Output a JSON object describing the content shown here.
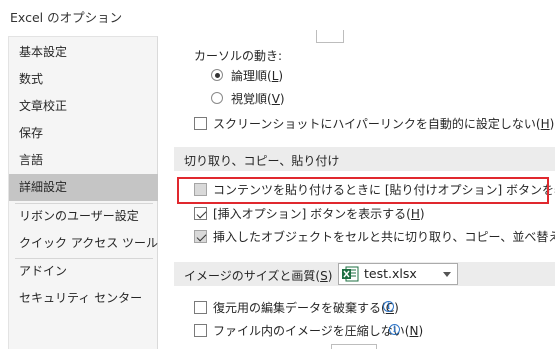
{
  "window": {
    "title": "Excel のオプション"
  },
  "sidebar": {
    "items": [
      {
        "label": "基本設定"
      },
      {
        "label": "数式"
      },
      {
        "label": "文章校正"
      },
      {
        "label": "保存"
      },
      {
        "label": "言語"
      },
      {
        "label": "詳細設定",
        "selected": true
      },
      {
        "label": "リボンのユーザー設定"
      },
      {
        "label": "クイック アクセス ツール バー"
      },
      {
        "label": "アドイン"
      },
      {
        "label": "セキュリティ センター"
      }
    ]
  },
  "cursor_movement": {
    "label": "カーソルの動き:",
    "logical": {
      "text": "論理順(",
      "key": "L",
      "close": ")",
      "selected": true
    },
    "visual": {
      "text": "視覚順(",
      "key": "V",
      "close": ")",
      "selected": false
    }
  },
  "screenshot_hyperlink": {
    "text": "スクリーンショットにハイパーリンクを自動的に設定しない(",
    "key": "H",
    "close": ")",
    "checked": false
  },
  "cut_copy_paste": {
    "header": "切り取り、コピー、貼り付け",
    "paste_options": {
      "text": "コンテンツを貼り付けるときに [貼り付けオプション] ボタンを表示する(",
      "key": "S",
      "close": ")",
      "checked": false,
      "disabled": true
    },
    "insert_options": {
      "text": "[挿入オプション] ボタンを表示する(",
      "key": "H",
      "close": ")",
      "checked": true
    },
    "move_with_cells": {
      "text": "挿入したオブジェクトをセルと共に切り取り、コピー、並べ替えを行う(",
      "key": "O",
      "close": ")",
      "checked": true,
      "disabled": true
    }
  },
  "image_size": {
    "header_text": "イメージのサイズと画質(",
    "header_key": "S",
    "header_close": ")",
    "file": "test.xlsx",
    "file_icon": "excel-file-icon",
    "discard_edit": {
      "text": "復元用の編集データを破棄する(",
      "key": "C",
      "close": ")",
      "checked": false
    },
    "no_compress": {
      "text": "ファイル内のイメージを圧縮しない(",
      "key": "N",
      "close": ")",
      "checked": false
    }
  },
  "colors": {
    "highlight": "#e0282e",
    "selected_nav": "#c5c5c5",
    "section_bg": "#ececec",
    "excel_green": "#1d6f42",
    "info_blue": "#2e75c7"
  }
}
